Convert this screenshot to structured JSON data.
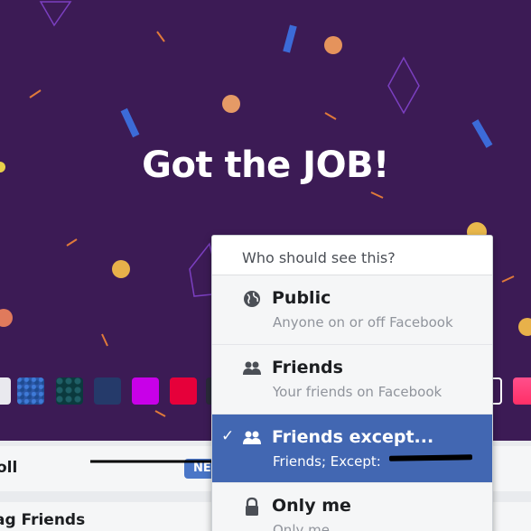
{
  "post": {
    "headline": "Got the JOB!",
    "background_color": "#3c1b55"
  },
  "composer": {
    "poll_label": "oll",
    "new_badge": "NE",
    "tag_label": "ag Friends"
  },
  "audience_menu": {
    "header": "Who should see this?",
    "options": [
      {
        "icon": "globe-icon",
        "title": "Public",
        "description": "Anyone on or off Facebook",
        "selected": false
      },
      {
        "icon": "friends-icon",
        "title": "Friends",
        "description": "Your friends on Facebook",
        "selected": false
      },
      {
        "icon": "friends-icon",
        "title": "Friends except...",
        "description": "Friends; Except:",
        "selected": true
      },
      {
        "icon": "lock-icon",
        "title": "Only me",
        "description": "Only me",
        "selected": false
      }
    ],
    "selected_color": "#4267b2",
    "check_glyph": "✓"
  },
  "swatch_colors": [
    "#e9e9ee",
    "#2c58a8",
    "#0b3a3e",
    "#253a6a",
    "#c800e8",
    "#e6003a",
    "#2a2a3a",
    "transparent",
    "#ff4f8b"
  ]
}
